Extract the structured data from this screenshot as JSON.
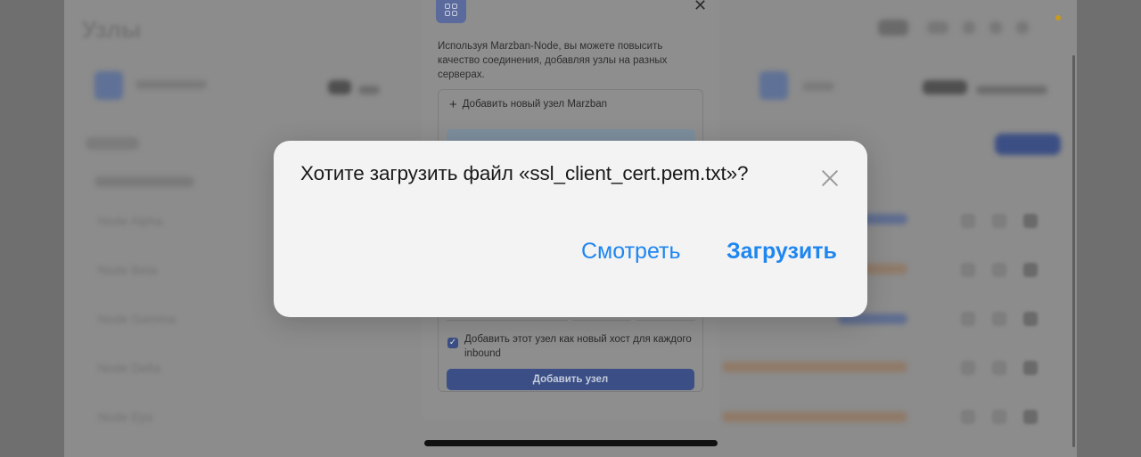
{
  "background": {
    "page_title": "Узлы",
    "row_labels": [
      "Node Alpha",
      "Node Beta",
      "Node Gamma",
      "Node Delta",
      "Node Eps"
    ]
  },
  "node_modal": {
    "description": "Используя Marzban-Node, вы можете повысить качество соединения, добавляя узлы на разных серверах.",
    "add_node_label": "Добавить новый узел Marzban",
    "add_host_checkbox_label": "Добавить этот узел как новый хост для каждого inbound",
    "add_host_checked": true,
    "submit_label": "Добавить узел"
  },
  "download_alert": {
    "title": "Хотите загрузить файл «ssl_client_cert.pem.txt»?",
    "view_label": "Смотреть",
    "upload_label": "Загрузить",
    "accent_color": "#1f86f0"
  }
}
